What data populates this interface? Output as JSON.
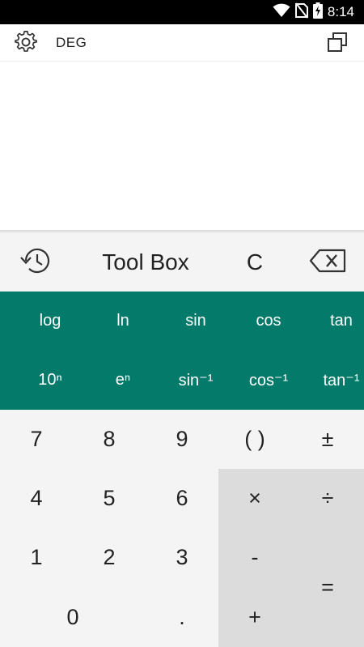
{
  "status_bar": {
    "time": "8:14",
    "icons": [
      "wifi-icon",
      "no-sim-icon",
      "battery-charging-icon"
    ]
  },
  "toolbar": {
    "angle_mode": "DEG",
    "settings_icon": "gear-icon",
    "window_icon": "float-window-icon"
  },
  "display": {
    "expression": "",
    "result": ""
  },
  "actions": {
    "history_icon": "history-icon",
    "toolbox_label": "Tool Box",
    "clear_label": "C",
    "backspace_icon": "backspace-icon"
  },
  "functions": {
    "row1": [
      "log",
      "ln",
      "sin",
      "cos",
      "tan"
    ],
    "row2": [
      "10ⁿ",
      "eⁿ",
      "sin⁻¹",
      "cos⁻¹",
      "tan⁻¹"
    ]
  },
  "keypad": {
    "row1": [
      "7",
      "8",
      "9",
      "( )",
      "±"
    ],
    "row2": [
      "4",
      "5",
      "6",
      "×",
      "÷"
    ],
    "row3": [
      "1",
      "2",
      "3",
      "-"
    ],
    "row4": [
      "0",
      ".",
      "+"
    ],
    "equals": "="
  },
  "colors": {
    "function_panel": "#047a6a",
    "keypad_bg": "#f4f4f4",
    "operator_bg": "#dcdcdc"
  }
}
